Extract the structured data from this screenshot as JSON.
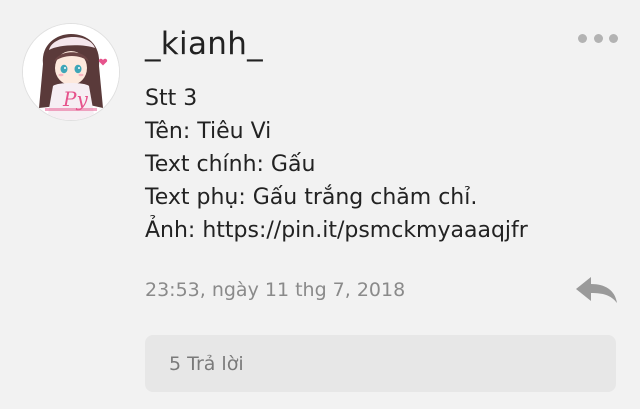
{
  "comment": {
    "username": "_kianh_",
    "lines": [
      "Stt 3",
      "Tên: Tiêu Vi",
      "Text chính: Gấu",
      "Text phụ: Gấu trắng chăm chỉ.",
      "Ảnh: https://pin.it/psmckmyaaaqjfr"
    ],
    "timestamp": "23:53, ngày 11 thg 7, 2018",
    "replies_label": "5 Trả lời"
  },
  "icons": {
    "more": "more-horizontal-icon",
    "reply": "reply-arrow-icon"
  },
  "colors": {
    "background": "#f2f2f2",
    "text": "#222222",
    "muted": "#8a8a8a",
    "icon": "#b3b3b3",
    "reply_box": "#e7e7e7"
  }
}
